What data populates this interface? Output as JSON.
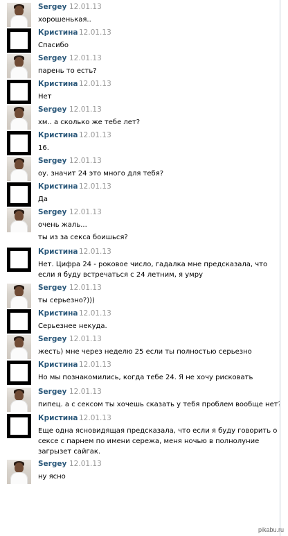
{
  "messages": [
    {
      "author": "Sergey",
      "date": "12.01.13",
      "text": "хорошенькая.."
    },
    {
      "author": "Кристина",
      "date": "12.01.13",
      "text": "Спасибо"
    },
    {
      "author": "Sergey",
      "date": "12.01.13",
      "text": "парень то есть?"
    },
    {
      "author": "Кристина",
      "date": "12.01.13",
      "text": "Нет"
    },
    {
      "author": "Sergey",
      "date": "12.01.13",
      "text": "хм.. а сколько же тебе лет?"
    },
    {
      "author": "Кристина",
      "date": "12.01.13",
      "text": "16."
    },
    {
      "author": "Sergey",
      "date": "12.01.13",
      "text": "оу. значит 24 это много для тебя?"
    },
    {
      "author": "Кристина",
      "date": "12.01.13",
      "text": "Да"
    },
    {
      "author": "Sergey",
      "date": "12.01.13",
      "text": "очень жаль...",
      "text2": "ты из за секса боишься?"
    },
    {
      "author": "Кристина",
      "date": "12.01.13",
      "text": "Нет. Цифра 24 - роковое число, гадалка мне предсказала, что если я буду встречаться с 24 летним, я умру"
    },
    {
      "author": "Sergey",
      "date": "12.01.13",
      "text": "ты серьезно?)))"
    },
    {
      "author": "Кристина",
      "date": "12.01.13",
      "text": "Серьезнее некуда."
    },
    {
      "author": "Sergey",
      "date": "12.01.13",
      "text": "жесть) мне через неделю 25 если ты полностью серьезно"
    },
    {
      "author": "Кристина",
      "date": "12.01.13",
      "text": "Но мы познакомились, когда тебе 24. Я не хочу рисковать"
    },
    {
      "author": "Sergey",
      "date": "12.01.13",
      "text": "пипец. а с сексом  ты хочешь сказать у тебя проблем вообще нет??"
    },
    {
      "author": "Кристина",
      "date": "12.01.13",
      "text": "Еще одна ясновидящая предсказала,  что если я буду говорить о сексе с парнем по  имени сережа, меня  ночью в полнолуние загрызет сайгак."
    },
    {
      "author": "Sergey",
      "date": "12.01.13",
      "text": "ну ясно"
    }
  ],
  "watermark": "pikabu.ru"
}
